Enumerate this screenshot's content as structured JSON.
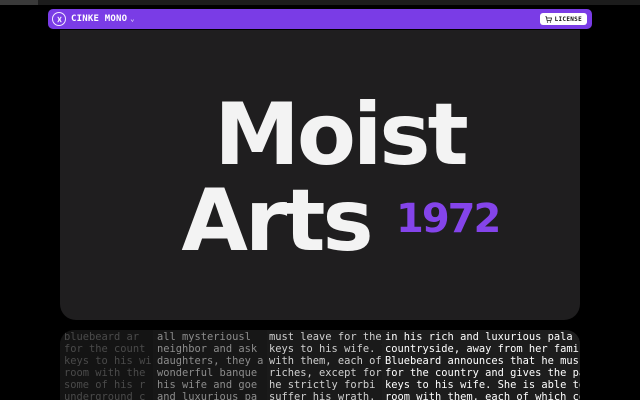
{
  "navbar": {
    "brand": "CINKE MONO",
    "brand_chevron": "⌄",
    "license_label": "LICENSE",
    "accent_color": "#7a3ce6"
  },
  "progress_fraction": 0.06,
  "hero": {
    "line1": "Moist",
    "line2": "Arts",
    "year": "1972",
    "year_color": "#8444ea"
  },
  "specimen": {
    "columns": [
      [
        "bluebeard ar",
        "for the count",
        "keys to his wi",
        "room with the",
        "some of his r",
        "underground c"
      ],
      [
        "all mysteriousl",
        "neighbor and ask",
        "daughters, they a",
        "wonderful banque",
        "his wife and goe",
        "and luxurious pa"
      ],
      [
        "must leave for the",
        "keys to his wife. Y",
        "with them, each of",
        "riches, except for",
        "he strictly forbi",
        "suffer his wrath."
      ],
      [
        "in his rich and luxurious pala",
        "countryside, away from her fami",
        "Bluebeard announces that he mus",
        "for the country and gives the pa",
        "keys to his wife. She is able to",
        "room with them, each of which co"
      ]
    ]
  },
  "icons": {
    "logo": "cinke-logo-icon",
    "chevron": "chevron-down-icon",
    "cart": "cart-icon"
  }
}
